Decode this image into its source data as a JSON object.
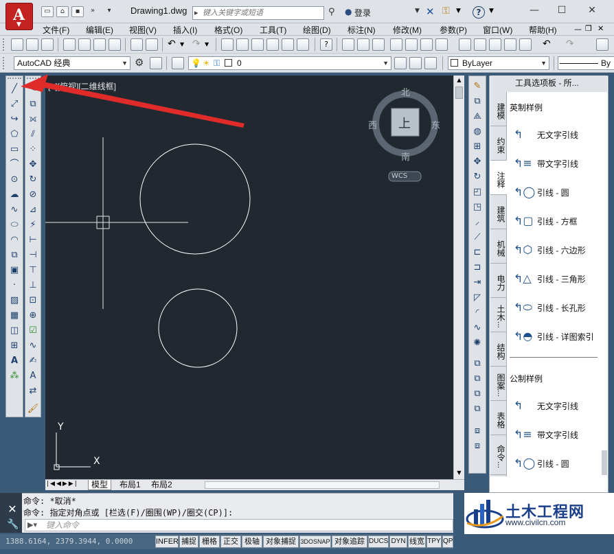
{
  "window": {
    "title": "Drawing1.dwg",
    "search_placeholder": "键入关键字或短语",
    "login": "登录",
    "app_logo": "A"
  },
  "menu": [
    "文件(F)",
    "编辑(E)",
    "视图(V)",
    "插入(I)",
    "格式(O)",
    "工具(T)",
    "绘图(D)",
    "标注(N)",
    "修改(M)",
    "参数(P)",
    "窗口(W)",
    "帮助(H)"
  ],
  "workspace": {
    "value": "AutoCAD 经典"
  },
  "layer": {
    "value": "0"
  },
  "linetype_color": {
    "value": "ByLayer"
  },
  "lineweight": {
    "value": "By"
  },
  "viewport": {
    "label": "[−][俯视][二维线框]"
  },
  "viewcube": {
    "top": "上",
    "north": "北",
    "south": "南",
    "east": "东",
    "west": "西",
    "wcs": "WCS"
  },
  "ucs": {
    "x": "X",
    "y": "Y"
  },
  "layout_tabs": [
    "模型",
    "布局1",
    "布局2"
  ],
  "palette": {
    "title": "工具选项板 - 所...",
    "tabs": [
      "建模",
      "约束",
      "注释",
      "建筑",
      "机械",
      "电力",
      "土木...",
      "结构",
      "图案...",
      "表格",
      "命令..."
    ],
    "sections": [
      {
        "header": "英制样例",
        "items": [
          "无文字引线",
          "带文字引线",
          "引线 - 圆",
          "引线 - 方框",
          "引线 - 六边形",
          "引线 - 三角形",
          "引线 - 长孔形",
          "引线 - 详图索引"
        ]
      },
      {
        "header": "公制样例",
        "items": [
          "无文字引线",
          "带文字引线",
          "引线 - 圆"
        ]
      }
    ]
  },
  "command": {
    "history": [
      "命令: *取消*",
      "命令: 指定对角点或 [栏选(F)/圈围(WP)/圈交(CP)]:"
    ],
    "placeholder": "键入命令"
  },
  "status": {
    "coords": "1388.6164, 2379.3944, 0.0000",
    "buttons": [
      "INFER",
      "捕捉",
      "栅格",
      "正交",
      "极轴",
      "对象捕捉",
      "3DOSNAP",
      "对象追踪",
      "DUCS",
      "DYN",
      "线宽",
      "TPY",
      "QP"
    ]
  },
  "watermark": {
    "title": "土木工程网",
    "url": "www.civilcn.com"
  },
  "colors": {
    "drawing_bg": "#212830",
    "annotation_arrow": "#e02b2b",
    "app_red": "#c42121"
  }
}
